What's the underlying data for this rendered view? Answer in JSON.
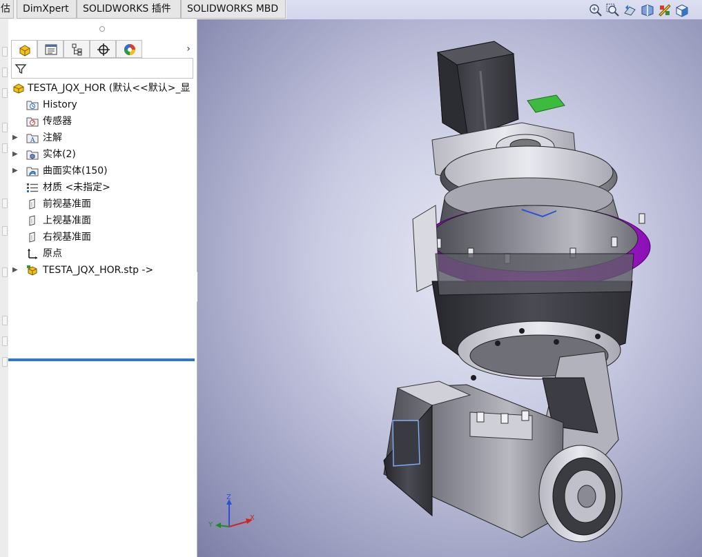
{
  "command_tabs": [
    {
      "label": "估"
    },
    {
      "label": "DimXpert"
    },
    {
      "label": "SOLIDWORKS 插件"
    },
    {
      "label": "SOLIDWORKS MBD"
    }
  ],
  "view_toolbar": {
    "icons": [
      "zoom-to-fit-icon",
      "zoom-to-area-icon",
      "previous-view-icon",
      "section-view-icon",
      "view-setting-icon",
      "view-orientation-icon"
    ]
  },
  "feature_manager": {
    "tabs": [
      {
        "icon": "featuremanager-tree-icon",
        "active": true
      },
      {
        "icon": "propertymanager-icon",
        "active": false
      },
      {
        "icon": "configurationmanager-icon",
        "active": false
      },
      {
        "icon": "dimxpertmanager-icon",
        "active": false
      },
      {
        "icon": "displaymanager-icon",
        "active": false
      }
    ],
    "more_label": "›",
    "root": {
      "label": "TESTA_JQX_HOR  (默认<<默认>_显"
    },
    "items": [
      {
        "label": "History",
        "icon": "history-folder-icon",
        "expandable": false
      },
      {
        "label": "传感器",
        "icon": "sensors-folder-icon",
        "expandable": false
      },
      {
        "label": "注解",
        "icon": "annotations-folder-icon",
        "expandable": true
      },
      {
        "label": "实体(2)",
        "icon": "solid-bodies-folder-icon",
        "expandable": true
      },
      {
        "label": "曲面实体(150)",
        "icon": "surface-bodies-folder-icon",
        "expandable": true
      },
      {
        "label": "材质 <未指定>",
        "icon": "material-icon",
        "expandable": false
      },
      {
        "label": "前视基准面",
        "icon": "plane-icon",
        "expandable": false
      },
      {
        "label": "上视基准面",
        "icon": "plane-icon",
        "expandable": false
      },
      {
        "label": "右视基准面",
        "icon": "plane-icon",
        "expandable": false
      },
      {
        "label": "原点",
        "icon": "origin-icon",
        "expandable": false
      },
      {
        "label": "TESTA_JQX_HOR.stp ->",
        "icon": "imported-feature-icon",
        "expandable": true
      }
    ]
  },
  "triad": {
    "x": "X",
    "y": "Y",
    "z": "Z"
  },
  "colors": {
    "accent_blue": "#2f78c4",
    "flange_purple": "#b01ad8",
    "motor_dark": "#3b3b42",
    "body_grey": "#9a9aa4"
  }
}
